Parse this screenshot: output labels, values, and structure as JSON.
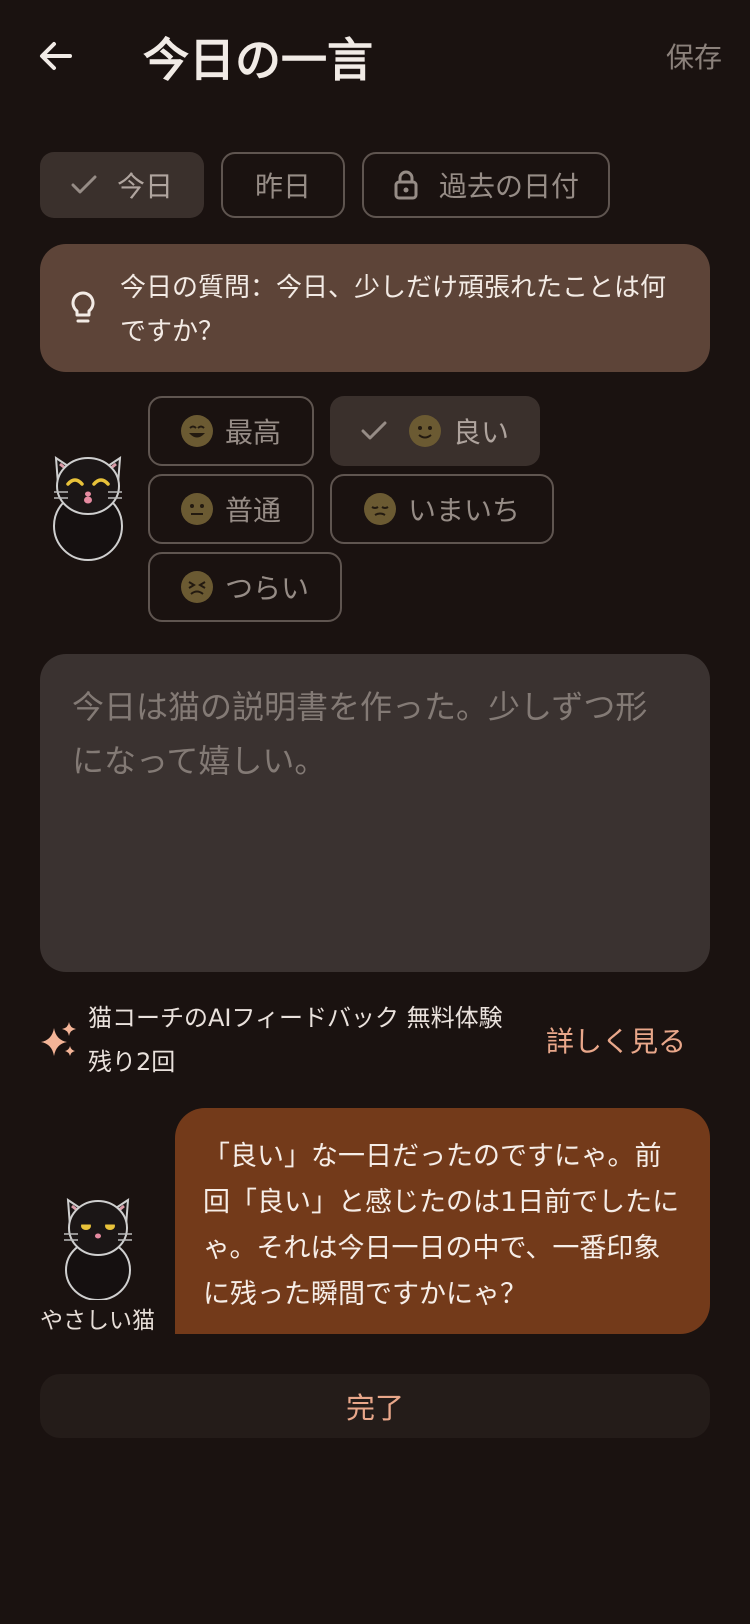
{
  "header": {
    "title": "今日の一言",
    "save_label": "保存"
  },
  "date_tabs": [
    {
      "label": "今日",
      "selected": true
    },
    {
      "label": "昨日",
      "selected": false
    },
    {
      "label": "過去の日付",
      "selected": false,
      "locked": true
    }
  ],
  "question": {
    "text": "今日の質問：今日、少しだけ頑張れたことは何ですか？"
  },
  "moods": [
    {
      "label": "最高",
      "emoji": "grinning-face",
      "selected": false
    },
    {
      "label": "良い",
      "emoji": "slightly-smiling-face",
      "selected": true
    },
    {
      "label": "普通",
      "emoji": "neutral-face",
      "selected": false
    },
    {
      "label": "いまいち",
      "emoji": "pensive-face",
      "selected": false
    },
    {
      "label": "つらい",
      "emoji": "persevering-face",
      "selected": false
    }
  ],
  "journal": {
    "value": "",
    "placeholder": "今日は猫の説明書を作った。少しずつ形になって嬉しい。"
  },
  "ai_feedback": {
    "line1": "猫コーチのAIフィードバック 無料体験",
    "line2": "残り2回",
    "details_label": "詳しく見る"
  },
  "chat": {
    "cat_name": "やさしい猫",
    "message": "「良い」な一日だったのですにゃ。前回「良い」と感じたのは1日前でしたにゃ。それは今日一日の中で、一番印象に残った瞬間ですかにゃ？"
  },
  "done_label": "完了",
  "colors": {
    "background": "#1a1210",
    "question_card": "#5d4438",
    "bubble": "#733a1a",
    "accent": "#e9a78a"
  }
}
